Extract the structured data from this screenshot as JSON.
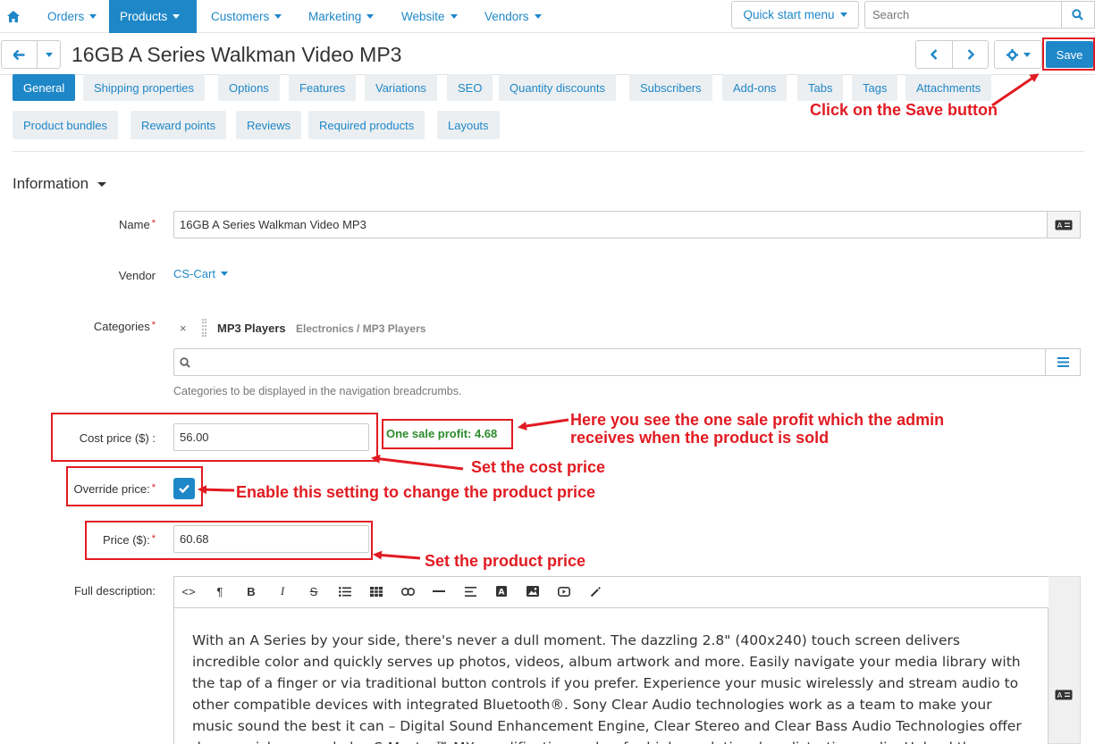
{
  "nav": {
    "items": [
      "Orders",
      "Products",
      "Customers",
      "Marketing",
      "Website",
      "Vendors"
    ],
    "quick_start": "Quick start menu",
    "search_placeholder": "Search"
  },
  "header": {
    "title": "16GB A Series Walkman Video MP3",
    "save_label": "Save"
  },
  "tabs": {
    "row1": [
      "General",
      "Shipping properties",
      "Options",
      "Features",
      "Variations",
      "SEO",
      "Quantity discounts",
      "Subscribers",
      "Add-ons",
      "Tabs",
      "Tags",
      "Attachments"
    ],
    "row2": [
      "Product bundles",
      "Reward points",
      "Reviews",
      "Required products",
      "Layouts"
    ]
  },
  "section": {
    "title": "Information"
  },
  "form": {
    "name_label": "Name",
    "name_value": "16GB A Series Walkman Video MP3",
    "vendor_label": "Vendor",
    "vendor_value": "CS-Cart",
    "categories_label": "Categories",
    "category_name": "MP3 Players",
    "category_path": "Electronics / MP3 Players",
    "categories_hint": "Categories to be displayed in the navigation breadcrumbs.",
    "cost_label": "Cost price ($) :",
    "cost_value": "56.00",
    "profit_text": "One sale profit: 4.68",
    "override_label": "Override price:",
    "override_checked": true,
    "price_label": "Price ($):",
    "price_value": "60.68",
    "desc_label": "Full description:",
    "description": "With an A Series by your side, there's never a dull moment. The dazzling 2.8\" (400x240) touch screen delivers incredible color and quickly serves up photos, videos, album artwork and more. Easily navigate your media library with the tap of a finger or via traditional button controls if you prefer. Experience your music wirelessly and stream audio to other compatible devices with integrated Bluetooth®. Sony Clear Audio technologies work as a team to make your music sound the best it can – Digital Sound Enhancement Engine, Clear Stereo and Clear Bass Audio Technologies offer deeper, richer sound plus S-Master™ MX amplification makes for high resolution, low distortion audio. Upload the matching lyric files and learn the words to your favorite songs."
  },
  "annotations": {
    "save": "Click on the Save button",
    "profit_line1": "Here you see the one sale profit which the admin",
    "profit_line2": "receives when the product is sold",
    "cost": "Set the cost price",
    "override": "Enable this setting to change the product price",
    "price": "Set the product price"
  },
  "colors": {
    "accent": "#1e87c8",
    "annotation_red": "#e11b22",
    "profit_green": "#2b8a2b"
  }
}
